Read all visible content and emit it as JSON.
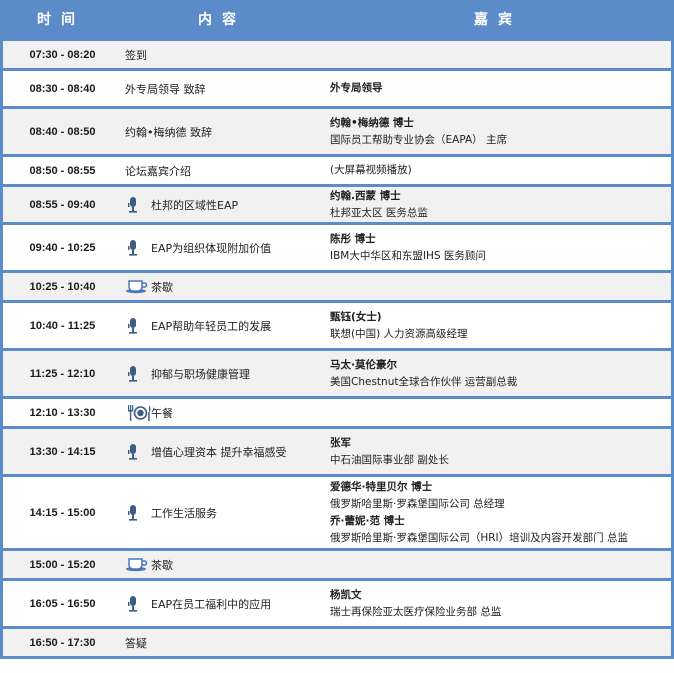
{
  "header": {
    "time": "时间",
    "content": "内容",
    "guest": "嘉宾"
  },
  "rows": [
    {
      "time": "07:30 - 08:20",
      "content": "签到",
      "icon": "",
      "guests": []
    },
    {
      "time": "08:30 - 08:40",
      "content": "外专局领导 致辞",
      "icon": "",
      "guests": [
        {
          "name": "外专局领导",
          "title": ""
        }
      ]
    },
    {
      "time": "08:40 - 08:50",
      "content": "约翰•梅纳德 致辞",
      "icon": "",
      "guests": [
        {
          "name": "约翰•梅纳德 博士",
          "title": "国际员工帮助专业协会（EAPA） 主席"
        }
      ]
    },
    {
      "time": "08:50 - 08:55",
      "content": "论坛嘉宾介绍",
      "icon": "",
      "guests": [
        {
          "name": "",
          "title": "(大屏幕视频播放)"
        }
      ]
    },
    {
      "time": "08:55 - 09:40",
      "content": "杜邦的区域性EAP",
      "icon": "microphone-icon",
      "guests": [
        {
          "name": "约翰.西蒙 博士",
          "title": "杜邦亚太区 医务总监"
        }
      ]
    },
    {
      "time": "09:40 - 10:25",
      "content": "EAP为组织体现附加价值",
      "icon": "microphone-icon",
      "guests": [
        {
          "name": "陈彤 博士",
          "title": "IBM大中华区和东盟IHS 医务顾问"
        }
      ]
    },
    {
      "time": "10:25 - 10:40",
      "content": "茶歇",
      "icon": "coffee-cup-icon",
      "guests": []
    },
    {
      "time": "10:40 - 11:25",
      "content": "EAP帮助年轻员工的发展",
      "icon": "microphone-icon",
      "guests": [
        {
          "name": "甄钰(女士)",
          "title": "联想(中国) 人力资源高级经理"
        }
      ]
    },
    {
      "time": "11:25 - 12:10",
      "content": "抑郁与职场健康管理",
      "icon": "microphone-icon",
      "guests": [
        {
          "name": "马太·莫伦豪尔",
          "title": "美国Chestnut全球合作伙伴 运营副总裁"
        }
      ]
    },
    {
      "time": "12:10 - 13:30",
      "content": "午餐",
      "icon": "cutlery-icon",
      "guests": []
    },
    {
      "time": "13:30 - 14:15",
      "content": "增值心理资本 提升幸福感受",
      "icon": "microphone-icon",
      "guests": [
        {
          "name": "张军",
          "title": "中石油国际事业部 副处长"
        }
      ]
    },
    {
      "time": "14:15 - 15:00",
      "content": "工作生活服务",
      "icon": "microphone-icon",
      "guests": [
        {
          "name": "爱德华·特里贝尔  博士",
          "title": "俄罗斯哈里斯·罗森堡国际公司 总经理"
        },
        {
          "name": "乔·蕾妮·范 博士",
          "title": "俄罗斯哈里斯·罗森堡国际公司（HRI）培训及内容开发部门 总监"
        }
      ]
    },
    {
      "time": "15:00 - 15:20",
      "content": "茶歇",
      "icon": "coffee-cup-icon",
      "guests": []
    },
    {
      "time": "16:05 - 16:50",
      "content": "EAP在员工福利中的应用",
      "icon": "microphone-icon",
      "guests": [
        {
          "name": "杨凯文",
          "title": "瑞士再保险亚太医疗保险业务部 总监"
        }
      ]
    },
    {
      "time": "16:50 - 17:30",
      "content": "答疑",
      "icon": "",
      "guests": []
    }
  ]
}
